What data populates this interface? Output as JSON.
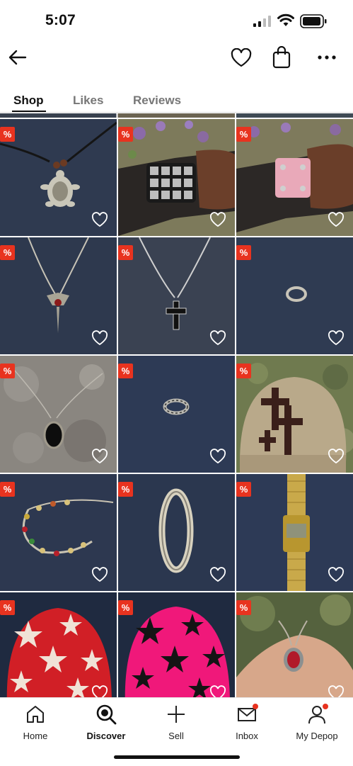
{
  "status_bar": {
    "time": "5:07"
  },
  "nav": {
    "icons": [
      "back-arrow-icon",
      "heart-icon",
      "shopping-bag-icon",
      "more-icon"
    ]
  },
  "tabs": [
    {
      "label": "Shop",
      "active": true
    },
    {
      "label": "Likes",
      "active": false
    },
    {
      "label": "Reviews",
      "active": false
    }
  ],
  "products": [
    {
      "item": "turtle-necklace",
      "badge": "%"
    },
    {
      "item": "studded-bracelet-black",
      "badge": "%"
    },
    {
      "item": "studded-bracelet-pink",
      "badge": "%"
    },
    {
      "item": "red-stone-dagger-necklace",
      "badge": "%"
    },
    {
      "item": "cross-necklace",
      "badge": "%"
    },
    {
      "item": "silver-ring",
      "badge": "%"
    },
    {
      "item": "black-oval-pendant",
      "badge": "%"
    },
    {
      "item": "patterned-ring",
      "badge": "%"
    },
    {
      "item": "cross-beanie",
      "badge": "%"
    },
    {
      "item": "gemstone-bracelet",
      "badge": "%"
    },
    {
      "item": "oval-hoop",
      "badge": "%"
    },
    {
      "item": "gold-digital-watch",
      "badge": "%"
    },
    {
      "item": "red-star-beanie",
      "badge": "%"
    },
    {
      "item": "pink-star-beanie",
      "badge": "%"
    },
    {
      "item": "red-gem-necklace",
      "badge": "%"
    }
  ],
  "bottom_nav": [
    {
      "label": "Home",
      "icon": "home-icon",
      "active": false,
      "dot": false
    },
    {
      "label": "Discover",
      "icon": "search-icon",
      "active": true,
      "dot": false
    },
    {
      "label": "Sell",
      "icon": "plus-icon",
      "active": false,
      "dot": false
    },
    {
      "label": "Inbox",
      "icon": "mail-icon",
      "active": false,
      "dot": true
    },
    {
      "label": "My Depop",
      "icon": "person-icon",
      "active": false,
      "dot": true
    }
  ],
  "colors": {
    "sale_badge": "#e8331f",
    "notification_dot": "#e8331f",
    "text": "#111111",
    "muted": "#777777"
  }
}
